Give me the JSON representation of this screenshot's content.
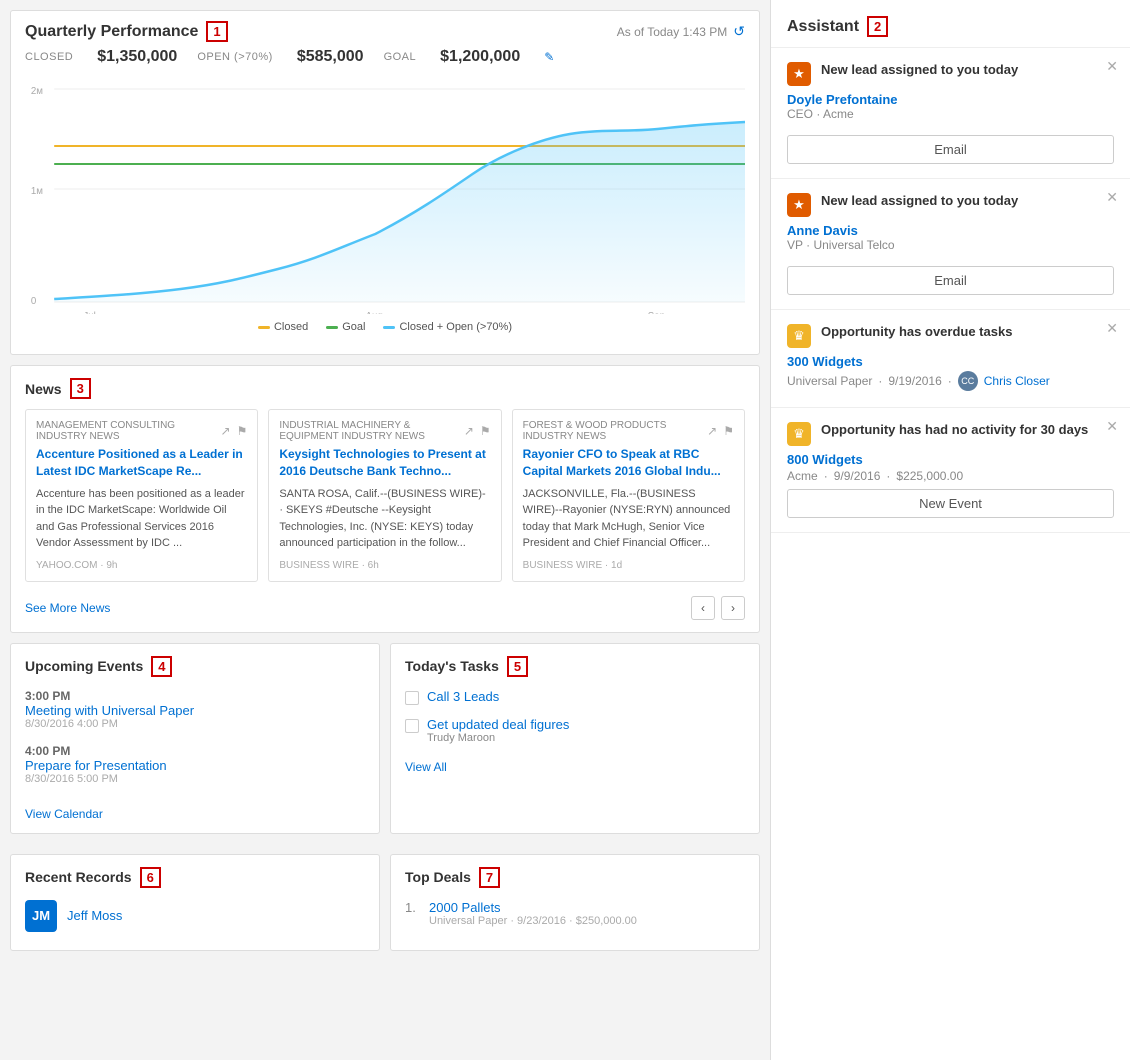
{
  "header": {
    "title": "Quarterly Performance",
    "badge": "1",
    "timestamp": "As of Today 1:43 PM",
    "closed_label": "CLOSED",
    "closed_value": "$1,350,000",
    "open_label": "OPEN (>70%)",
    "open_value": "$585,000",
    "goal_label": "GOAL",
    "goal_value": "$1,200,000"
  },
  "chart": {
    "y_labels": [
      "2м",
      "1м",
      "0"
    ],
    "x_labels": [
      "Jul",
      "Aug",
      "Sep"
    ],
    "legend": [
      {
        "label": "Closed",
        "color": "#f0b429"
      },
      {
        "label": "Goal",
        "color": "#4caf50"
      },
      {
        "label": "Closed + Open (>70%)",
        "color": "#4fc3f7"
      }
    ]
  },
  "news": {
    "title": "News",
    "badge": "3",
    "see_more": "See More News",
    "items": [
      {
        "source": "Management Consulting Industry News",
        "time": "YAHOO.COM · 9h",
        "headline": "Accenture Positioned as a Leader in Latest IDC MarketScape Re...",
        "body": "Accenture has been positioned as a leader in the IDC MarketScape: Worldwide Oil and Gas Professional Services 2016 Vendor Assessment by IDC ..."
      },
      {
        "source": "Industrial Machinery & Equipment Industry News",
        "time": "BUSINESS WIRE · 6h",
        "headline": "Keysight Technologies to Present at 2016 Deutsche Bank Techno...",
        "body": "SANTA ROSA, Calif.--(BUSINESS WIRE)- · SKEYS #Deutsche --Keysight Technologies, Inc. (NYSE: KEYS) today announced participation in the follow..."
      },
      {
        "source": "Forest & Wood Products Industry News",
        "time": "BUSINESS WIRE · 1d",
        "headline": "Rayonier CFO to Speak at RBC Capital Markets 2016 Global Indu...",
        "body": "JACKSONVILLE, Fla.--(BUSINESS WIRE)--Rayonier (NYSE:RYN) announced today that Mark McHugh, Senior Vice President and Chief Financial Officer..."
      }
    ]
  },
  "upcoming_events": {
    "title": "Upcoming Events",
    "badge": "4",
    "events": [
      {
        "time": "3:00 PM",
        "name": "Meeting with Universal Paper",
        "date": "8/30/2016 4:00 PM"
      },
      {
        "time": "4:00 PM",
        "name": "Prepare for Presentation",
        "date": "8/30/2016 5:00 PM"
      }
    ],
    "view_calendar": "View Calendar"
  },
  "tasks": {
    "title": "Today's Tasks",
    "badge": "5",
    "items": [
      {
        "name": "Call 3 Leads",
        "sub": ""
      },
      {
        "name": "Get updated deal figures",
        "sub": "Trudy Maroon"
      }
    ],
    "view_all": "View All"
  },
  "recent_records": {
    "title": "Recent Records",
    "badge": "6",
    "items": [
      {
        "name": "Jeff Moss",
        "initials": "JM"
      }
    ]
  },
  "top_deals": {
    "title": "Top Deals",
    "badge": "7",
    "items": [
      {
        "num": "1.",
        "name": "2000 Pallets",
        "sub": "Universal Paper · 9/23/2016 · $250,000.00"
      }
    ]
  },
  "assistant": {
    "title": "Assistant",
    "badge": "2",
    "cards": [
      {
        "type": "lead",
        "icon": "star",
        "label": "New lead assigned to you today",
        "person_name": "Doyle Prefontaine",
        "person_role": "CEO · Acme",
        "action": "Email"
      },
      {
        "type": "lead",
        "icon": "star",
        "label": "New lead assigned to you today",
        "person_name": "Anne Davis",
        "person_role": "VP · Universal Telco",
        "action": "Email"
      },
      {
        "type": "opportunity",
        "icon": "crown",
        "label": "Opportunity has overdue tasks",
        "opp_name": "300 Widgets",
        "opp_company": "Universal Paper",
        "opp_date": "9/19/2016",
        "opp_user": "Chris Closer"
      },
      {
        "type": "opportunity_inactive",
        "icon": "crown",
        "label": "Opportunity has had no activity for 30 days",
        "opp_name": "800 Widgets",
        "opp_company": "Acme",
        "opp_date": "9/9/2016",
        "opp_amount": "$225,000.00",
        "action": "New Event"
      }
    ]
  }
}
